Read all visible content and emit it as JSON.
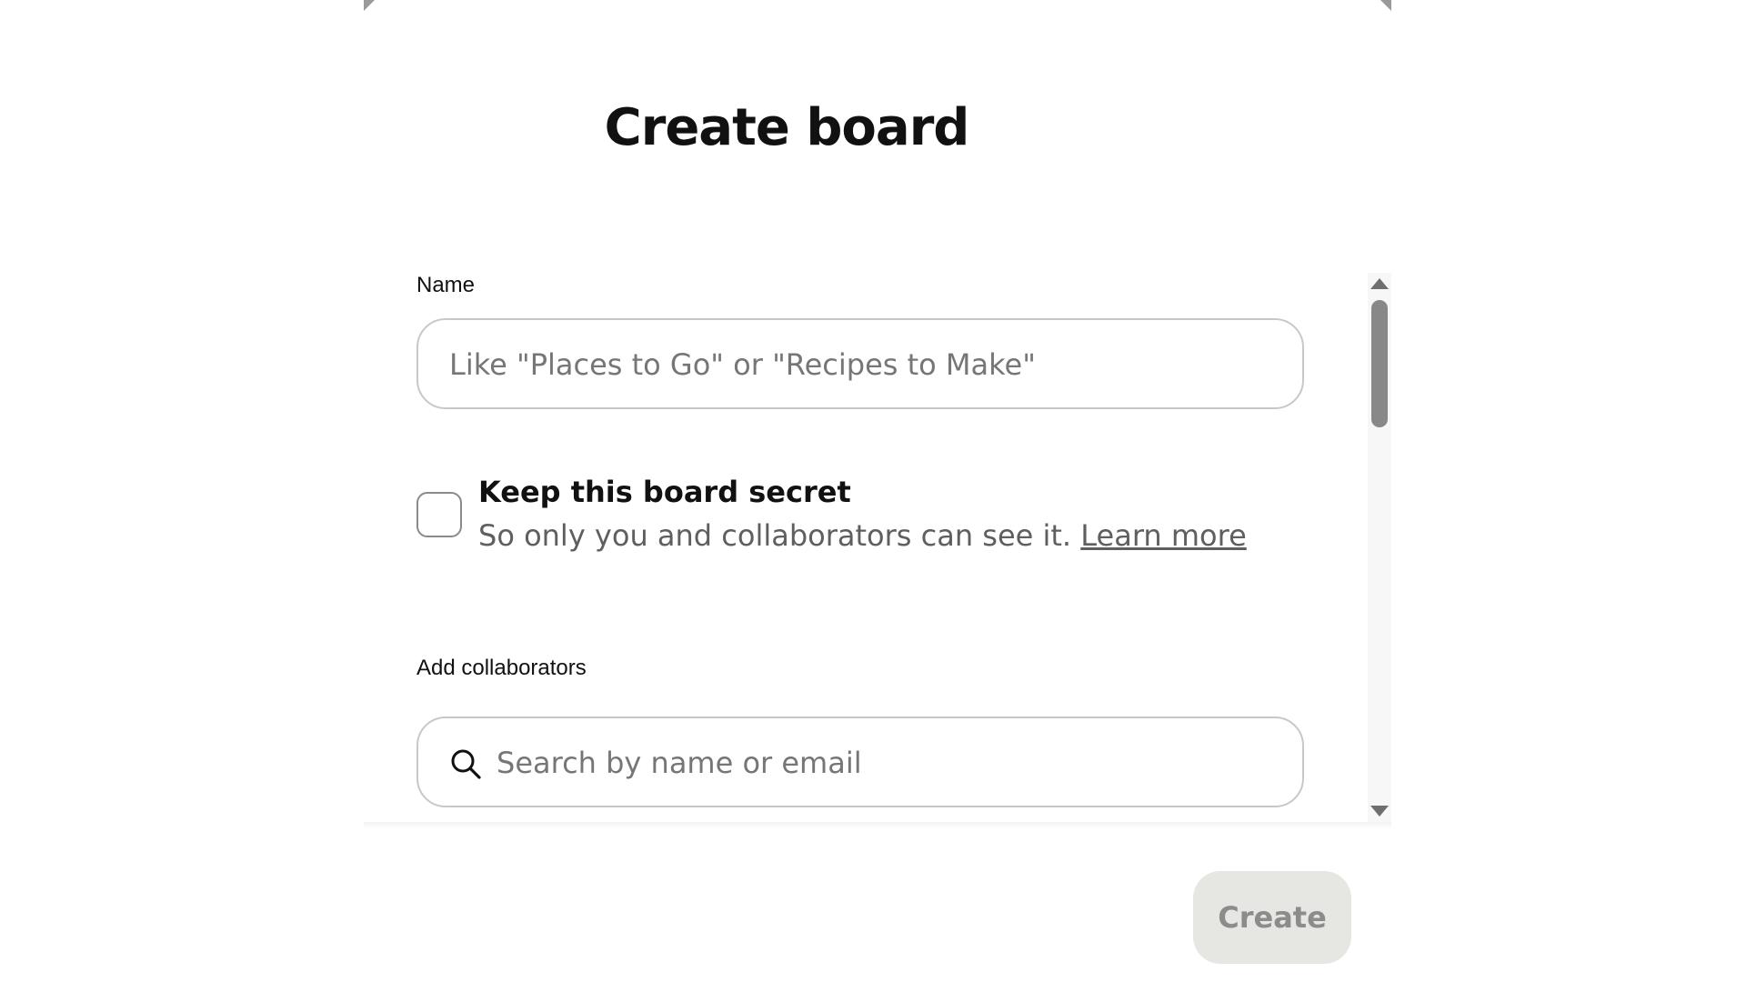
{
  "dialog": {
    "title": "Create board"
  },
  "name_field": {
    "label": "Name",
    "value": "",
    "placeholder": "Like \"Places to Go\" or \"Recipes to Make\""
  },
  "secret_option": {
    "checked": false,
    "title": "Keep this board secret",
    "description": "So only you and collaborators can see it.",
    "link_text": "Learn more"
  },
  "collaborators": {
    "label": "Add collaborators",
    "search_placeholder": "Search by name or email",
    "search_icon": "search-icon"
  },
  "footer": {
    "create_label": "Create",
    "create_enabled": false
  }
}
